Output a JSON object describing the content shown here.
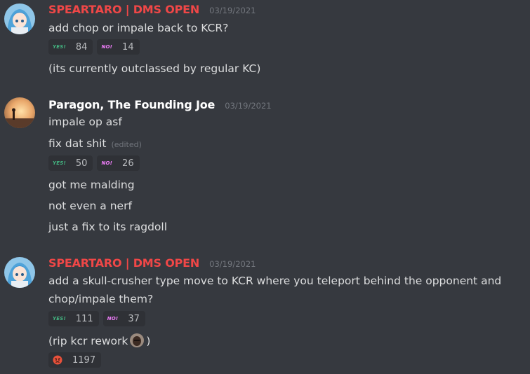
{
  "messages": [
    {
      "author": "SPEARTARO | DMS OPEN",
      "author_color": "#f04747",
      "timestamp": "03/19/2021",
      "lines": [
        "add chop or impale back to KCR?",
        "(its currently outclassed by regular KC)"
      ],
      "reactions": [
        {
          "emoji": "YES!",
          "count": "84"
        },
        {
          "emoji": "NO!",
          "count": "14"
        }
      ]
    },
    {
      "author": "Paragon, The Founding Joe",
      "author_color": "#ffffff",
      "timestamp": "03/19/2021",
      "lines": [
        "impale op asf",
        "fix dat shit",
        "got me malding",
        "not even a nerf",
        "just a fix to its ragdoll"
      ],
      "edited": "(edited)",
      "reactions": [
        {
          "emoji": "YES!",
          "count": "50"
        },
        {
          "emoji": "NO!",
          "count": "26"
        }
      ]
    },
    {
      "author": "SPEARTARO | DMS OPEN",
      "author_color": "#f04747",
      "timestamp": "03/19/2021",
      "lines": [
        "add a skull-crusher type move to KCR where you teleport behind the opponent and",
        "chop/impale them?",
        "(rip kcr rework",
        ")"
      ],
      "reactions": [
        {
          "emoji": "YES!",
          "count": "111"
        },
        {
          "emoji": "NO!",
          "count": "37"
        }
      ],
      "reactions2": [
        {
          "emoji": "angry-face",
          "count": "1197"
        }
      ]
    }
  ]
}
